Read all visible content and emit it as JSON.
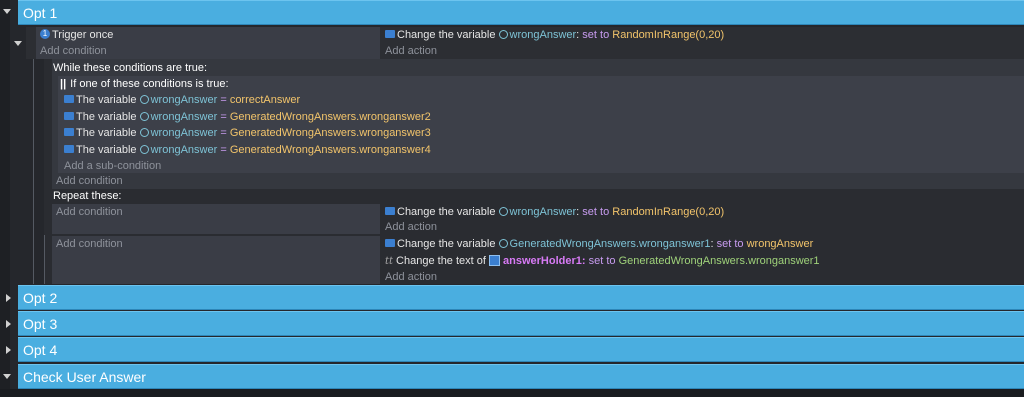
{
  "groups": {
    "opt1": "Opt 1",
    "opt2": "Opt 2",
    "opt3": "Opt 3",
    "opt4": "Opt 4",
    "check": "Check User Answer"
  },
  "event1": {
    "condition": "Trigger once",
    "add_condition": "Add condition",
    "action_prefix": "Change the variable",
    "action_var": "wrongAnswer",
    "action_colon": ":",
    "action_setto": "set to",
    "action_value": "RandomInRange(0,20)",
    "add_action": "Add action"
  },
  "while_block": {
    "header": "While these conditions are true:",
    "or_header": "If one of these conditions is true:",
    "conditions": [
      {
        "prefix": "The variable",
        "var": "wrongAnswer",
        "eq": "=",
        "value": "correctAnswer"
      },
      {
        "prefix": "The variable",
        "var": "wrongAnswer",
        "eq": "=",
        "value": "GeneratedWrongAnswers.wronganswer2"
      },
      {
        "prefix": "The variable",
        "var": "wrongAnswer",
        "eq": "=",
        "value": "GeneratedWrongAnswers.wronganswer3"
      },
      {
        "prefix": "The variable",
        "var": "wrongAnswer",
        "eq": "=",
        "value": "GeneratedWrongAnswers.wronganswer4"
      }
    ],
    "add_subcondition": "Add a sub-condition",
    "add_condition": "Add condition"
  },
  "repeat_block": {
    "header": "Repeat these:",
    "add_condition": "Add condition",
    "action1": {
      "prefix": "Change the variable",
      "var": "wrongAnswer",
      "colon": ":",
      "setto": "set to",
      "value": "RandomInRange(0,20)"
    },
    "add_action": "Add action"
  },
  "sub_event": {
    "add_condition": "Add condition",
    "action1": {
      "prefix": "Change the variable",
      "var": "GeneratedWrongAnswers.wronganswer1",
      "colon": ":",
      "setto": "set to",
      "value": "wrongAnswer"
    },
    "action2": {
      "prefix": "Change the text of",
      "obj": "answerHolder1",
      "colon": ":",
      "setto": "set to",
      "value": "GeneratedWrongAnswers.wronganswer1"
    },
    "add_action": "Add action"
  }
}
